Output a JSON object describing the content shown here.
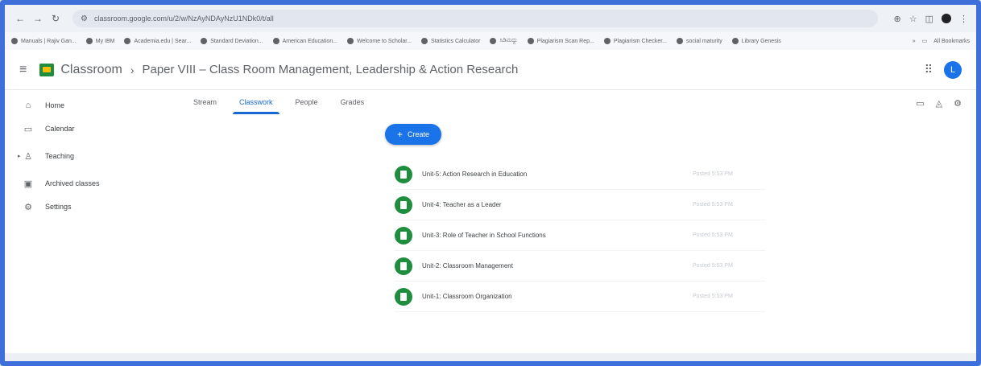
{
  "browser": {
    "url": "classroom.google.com/u/2/w/NzAyNDAyNzU1NDk0/t/all",
    "bookmarks": [
      "Manuals | Rajiv Gan...",
      "My IBM",
      "Academia.edu | Sear...",
      "Standard Deviation...",
      "American Education...",
      "Welcome to Scholar...",
      "Statistics Calculator",
      "ಸಿಡಿಮದ್ದು",
      "Plagiarism Scan Rep...",
      "Plagiarism Checker...",
      "social maturity",
      "Library Genesis"
    ],
    "all_bookmarks": "All Bookmarks",
    "more": "»"
  },
  "header": {
    "brand": "Classroom",
    "separator": "›",
    "course_title": "Paper VIII – Class Room Management, Leadership & Action Research",
    "avatar_initial": "L"
  },
  "sidebar": {
    "items": [
      {
        "label": "Home",
        "icon": "home-icon"
      },
      {
        "label": "Calendar",
        "icon": "calendar-icon"
      },
      {
        "label": "Teaching",
        "icon": "people-icon"
      },
      {
        "label": "Archived classes",
        "icon": "archive-icon"
      },
      {
        "label": "Settings",
        "icon": "gear-icon"
      }
    ]
  },
  "tabs": [
    "Stream",
    "Classwork",
    "People",
    "Grades"
  ],
  "active_tab": "Classwork",
  "create_label": "Create",
  "topics": [
    {
      "title": "Unit-5: Action Research in Education",
      "time": "Posted 5:53 PM"
    },
    {
      "title": "Unit-4: Teacher as a Leader",
      "time": "Posted 5:53 PM"
    },
    {
      "title": "Unit-3: Role of Teacher in School Functions",
      "time": "Posted 5:53 PM"
    },
    {
      "title": "Unit-2: Classroom Management",
      "time": "Posted 5:53 PM"
    },
    {
      "title": "Unit-1: Classroom Organization",
      "time": "Posted 5:53 PM"
    }
  ],
  "colors": {
    "accent": "#1a73e8",
    "topic_icon": "#1e8e3e",
    "frame": "#3f6fd8"
  }
}
